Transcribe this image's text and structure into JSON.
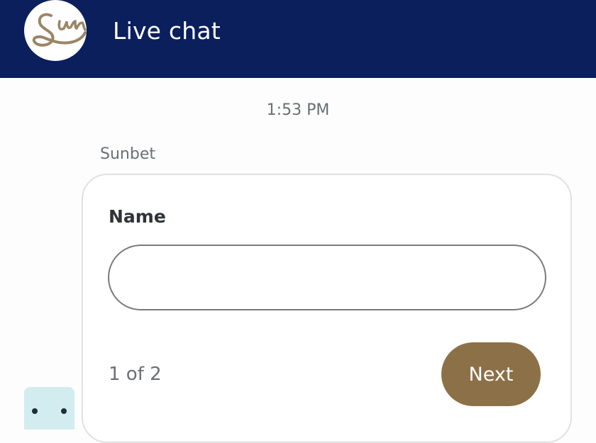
{
  "header": {
    "title": "Live chat",
    "logo_text": "Sun"
  },
  "chat": {
    "timestamp": "1:53 PM",
    "sender": "Sunbet"
  },
  "form": {
    "field_label": "Name",
    "name_value": "",
    "pager_text": "1 of 2",
    "next_label": "Next"
  },
  "colors": {
    "header_bg": "#0b1f5c",
    "accent": "#8c7048",
    "card_border": "#e1e1e1",
    "widget_bg": "#d3ecef"
  },
  "icons": {
    "logo": "sun-signature-logo",
    "widget": "chatbot-face-icon"
  }
}
